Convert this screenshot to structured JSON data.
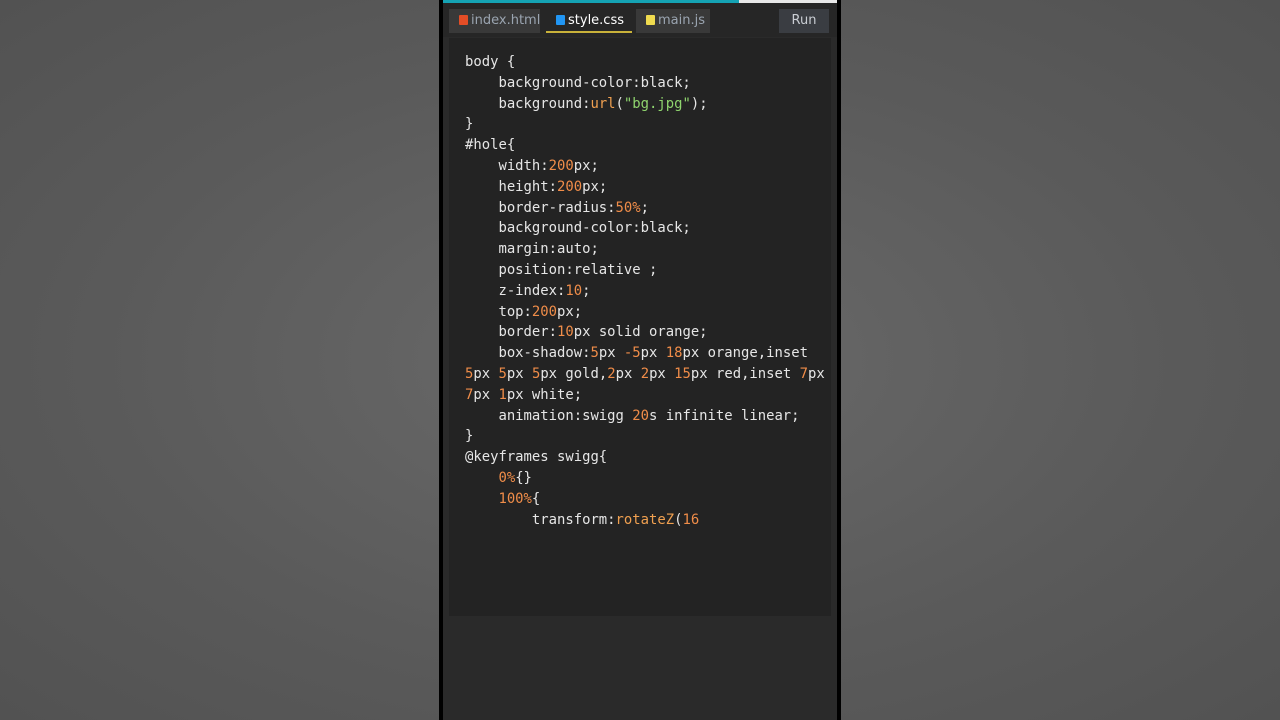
{
  "tabs": [
    {
      "label": "index.html",
      "icon": "html5-icon",
      "icon_color": "#e44d26",
      "active": false
    },
    {
      "label": "style.css",
      "icon": "css3-icon",
      "icon_color": "#2196f3",
      "active": true
    },
    {
      "label": "main.js",
      "icon": "js-icon",
      "icon_color": "#f0db4f",
      "active": false
    }
  ],
  "run_label": "Run",
  "video_progress": 0.75,
  "colors": {
    "number": "#f08d49",
    "function": "#f0a050",
    "string": "#8fd46e",
    "text": "#e6e6e6",
    "editor_bg": "#232323",
    "accent": "#15a3b4"
  },
  "code_lines": [
    [
      {
        "t": "plain",
        "v": "body {"
      }
    ],
    [
      {
        "t": "plain",
        "v": "    background-color:black;"
      }
    ],
    [
      {
        "t": "plain",
        "v": "    background:"
      },
      {
        "t": "fn",
        "v": "url"
      },
      {
        "t": "plain",
        "v": "("
      },
      {
        "t": "str",
        "v": "\"bg.jpg\""
      },
      {
        "t": "plain",
        "v": ");"
      }
    ],
    [
      {
        "t": "plain",
        "v": "}"
      }
    ],
    [
      {
        "t": "plain",
        "v": "#hole{"
      }
    ],
    [
      {
        "t": "plain",
        "v": "    width:"
      },
      {
        "t": "num",
        "v": "200"
      },
      {
        "t": "plain",
        "v": "px;"
      }
    ],
    [
      {
        "t": "plain",
        "v": "    height:"
      },
      {
        "t": "num",
        "v": "200"
      },
      {
        "t": "plain",
        "v": "px;"
      }
    ],
    [
      {
        "t": "plain",
        "v": "    border-radius:"
      },
      {
        "t": "num",
        "v": "50%"
      },
      {
        "t": "plain",
        "v": ";"
      }
    ],
    [
      {
        "t": "plain",
        "v": "    background-color:black;"
      }
    ],
    [
      {
        "t": "plain",
        "v": "    margin:auto;"
      }
    ],
    [
      {
        "t": "plain",
        "v": "    position:relative ;"
      }
    ],
    [
      {
        "t": "plain",
        "v": "    z-index:"
      },
      {
        "t": "num",
        "v": "10"
      },
      {
        "t": "plain",
        "v": ";"
      }
    ],
    [
      {
        "t": "plain",
        "v": "    top:"
      },
      {
        "t": "num",
        "v": "200"
      },
      {
        "t": "plain",
        "v": "px;"
      }
    ],
    [
      {
        "t": "plain",
        "v": "    border:"
      },
      {
        "t": "num",
        "v": "10"
      },
      {
        "t": "plain",
        "v": "px solid orange;"
      }
    ],
    [
      {
        "t": "plain",
        "v": "    box-shadow:"
      },
      {
        "t": "num",
        "v": "5"
      },
      {
        "t": "plain",
        "v": "px "
      },
      {
        "t": "num",
        "v": "-5"
      },
      {
        "t": "plain",
        "v": "px "
      },
      {
        "t": "num",
        "v": "18"
      },
      {
        "t": "plain",
        "v": "px orange,inset"
      }
    ],
    [
      {
        "t": "num",
        "v": "5"
      },
      {
        "t": "plain",
        "v": "px "
      },
      {
        "t": "num",
        "v": "5"
      },
      {
        "t": "plain",
        "v": "px "
      },
      {
        "t": "num",
        "v": "5"
      },
      {
        "t": "plain",
        "v": "px gold,"
      },
      {
        "t": "num",
        "v": "2"
      },
      {
        "t": "plain",
        "v": "px "
      },
      {
        "t": "num",
        "v": "2"
      },
      {
        "t": "plain",
        "v": "px "
      },
      {
        "t": "num",
        "v": "15"
      },
      {
        "t": "plain",
        "v": "px red,inset "
      },
      {
        "t": "num",
        "v": "7"
      },
      {
        "t": "plain",
        "v": "px"
      }
    ],
    [
      {
        "t": "num",
        "v": "7"
      },
      {
        "t": "plain",
        "v": "px "
      },
      {
        "t": "num",
        "v": "1"
      },
      {
        "t": "plain",
        "v": "px white;"
      }
    ],
    [
      {
        "t": "plain",
        "v": "    animation:swigg "
      },
      {
        "t": "num",
        "v": "20"
      },
      {
        "t": "plain",
        "v": "s infinite linear;"
      }
    ],
    [
      {
        "t": "plain",
        "v": "}"
      }
    ],
    [
      {
        "t": "plain",
        "v": "@keyframes swigg{"
      }
    ],
    [
      {
        "t": "plain",
        "v": "    "
      },
      {
        "t": "num",
        "v": "0%"
      },
      {
        "t": "plain",
        "v": "{}"
      }
    ],
    [
      {
        "t": "plain",
        "v": "    "
      },
      {
        "t": "num",
        "v": "100%"
      },
      {
        "t": "plain",
        "v": "{"
      }
    ],
    [
      {
        "t": "plain",
        "v": "        transform:"
      },
      {
        "t": "fn",
        "v": "rotateZ"
      },
      {
        "t": "plain",
        "v": "("
      },
      {
        "t": "num",
        "v": "16"
      }
    ]
  ]
}
